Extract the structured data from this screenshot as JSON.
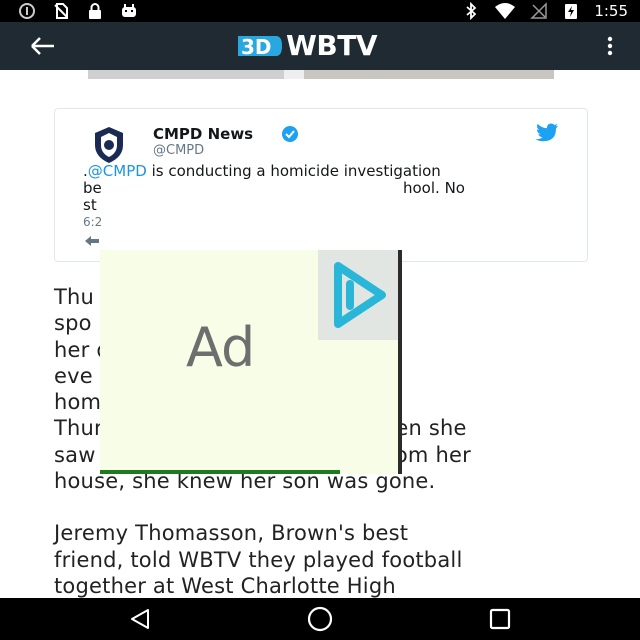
{
  "status_bar": {
    "time": "1:55",
    "left_icons": [
      "data-saver-icon",
      "no-sim-icon",
      "lock-icon",
      "android-debug-icon"
    ],
    "right_icons": [
      "bluetooth-icon",
      "wifi-icon",
      "signal-off-icon",
      "battery-charging-icon"
    ]
  },
  "app_bar": {
    "logo_mark": "3D",
    "logo_text": "WBTV"
  },
  "tweet": {
    "name": "CMPD News",
    "handle": "@CMPD",
    "line1_prefix": ".",
    "mention": "@CMPD",
    "line1_rest": " is conducting a homicide investigation",
    "line2": "be",
    "line2_right": "hool. No",
    "line3": "st",
    "time": "6:2"
  },
  "article": {
    "p1": [
      "Thu                              wn's mother",
      "spo                             ra. She said",
      "her                                dnesday",
      "eve                              d never came",
      "home. She reported him missing",
      "Thursday morning. She says when she",
      "saw the police activity not far from her",
      "house, she knew her son was gone."
    ],
    "p2": [
      "Jeremy Thomasson, Brown's best",
      "friend, told WBTV they played football",
      "together at West Charlotte High"
    ]
  },
  "ad": {
    "label": "Ad"
  },
  "colors": {
    "app_bar": "#1f2a33",
    "twitter_blue": "#1b95e0",
    "logo_blue": "#29a8e0",
    "ad_background": "#f8fde8",
    "ad_choices": "#29b6d8"
  }
}
